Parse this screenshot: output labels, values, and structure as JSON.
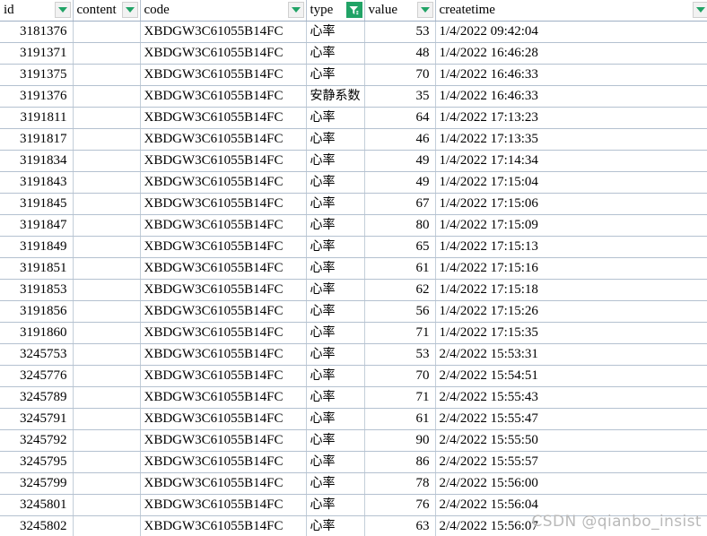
{
  "spreadsheet": {
    "columns": [
      {
        "key": "id",
        "label": "id",
        "align": "num",
        "filter": "dropdown"
      },
      {
        "key": "content",
        "label": "content",
        "align": "txt",
        "filter": "dropdown"
      },
      {
        "key": "code",
        "label": "code",
        "align": "txt",
        "filter": "dropdown"
      },
      {
        "key": "type",
        "label": "type",
        "align": "cn",
        "filter": "active"
      },
      {
        "key": "value",
        "label": "value",
        "align": "num",
        "filter": "dropdown"
      },
      {
        "key": "createtime",
        "label": "createtime",
        "align": "txt",
        "filter": "dropdown"
      }
    ],
    "rows": [
      {
        "id": "3181376",
        "content": "",
        "code": "XBDGW3C61055B14FC",
        "type": "心率",
        "value": "53",
        "createtime": "1/4/2022  09:42:04"
      },
      {
        "id": "3191371",
        "content": "",
        "code": "XBDGW3C61055B14FC",
        "type": "心率",
        "value": "48",
        "createtime": "1/4/2022  16:46:28"
      },
      {
        "id": "3191375",
        "content": "",
        "code": "XBDGW3C61055B14FC",
        "type": "心率",
        "value": "70",
        "createtime": "1/4/2022  16:46:33"
      },
      {
        "id": "3191376",
        "content": "",
        "code": "XBDGW3C61055B14FC",
        "type": "安静系数",
        "value": "35",
        "createtime": "1/4/2022  16:46:33"
      },
      {
        "id": "3191811",
        "content": "",
        "code": "XBDGW3C61055B14FC",
        "type": "心率",
        "value": "64",
        "createtime": "1/4/2022  17:13:23"
      },
      {
        "id": "3191817",
        "content": "",
        "code": "XBDGW3C61055B14FC",
        "type": "心率",
        "value": "46",
        "createtime": "1/4/2022  17:13:35"
      },
      {
        "id": "3191834",
        "content": "",
        "code": "XBDGW3C61055B14FC",
        "type": "心率",
        "value": "49",
        "createtime": "1/4/2022  17:14:34"
      },
      {
        "id": "3191843",
        "content": "",
        "code": "XBDGW3C61055B14FC",
        "type": "心率",
        "value": "49",
        "createtime": "1/4/2022  17:15:04"
      },
      {
        "id": "3191845",
        "content": "",
        "code": "XBDGW3C61055B14FC",
        "type": "心率",
        "value": "67",
        "createtime": "1/4/2022  17:15:06"
      },
      {
        "id": "3191847",
        "content": "",
        "code": "XBDGW3C61055B14FC",
        "type": "心率",
        "value": "80",
        "createtime": "1/4/2022  17:15:09"
      },
      {
        "id": "3191849",
        "content": "",
        "code": "XBDGW3C61055B14FC",
        "type": "心率",
        "value": "65",
        "createtime": "1/4/2022  17:15:13"
      },
      {
        "id": "3191851",
        "content": "",
        "code": "XBDGW3C61055B14FC",
        "type": "心率",
        "value": "61",
        "createtime": "1/4/2022  17:15:16"
      },
      {
        "id": "3191853",
        "content": "",
        "code": "XBDGW3C61055B14FC",
        "type": "心率",
        "value": "62",
        "createtime": "1/4/2022  17:15:18"
      },
      {
        "id": "3191856",
        "content": "",
        "code": "XBDGW3C61055B14FC",
        "type": "心率",
        "value": "56",
        "createtime": "1/4/2022  17:15:26"
      },
      {
        "id": "3191860",
        "content": "",
        "code": "XBDGW3C61055B14FC",
        "type": "心率",
        "value": "71",
        "createtime": "1/4/2022  17:15:35"
      },
      {
        "id": "3245753",
        "content": "",
        "code": "XBDGW3C61055B14FC",
        "type": "心率",
        "value": "53",
        "createtime": "2/4/2022  15:53:31"
      },
      {
        "id": "3245776",
        "content": "",
        "code": "XBDGW3C61055B14FC",
        "type": "心率",
        "value": "70",
        "createtime": "2/4/2022  15:54:51"
      },
      {
        "id": "3245789",
        "content": "",
        "code": "XBDGW3C61055B14FC",
        "type": "心率",
        "value": "71",
        "createtime": "2/4/2022  15:55:43"
      },
      {
        "id": "3245791",
        "content": "",
        "code": "XBDGW3C61055B14FC",
        "type": "心率",
        "value": "61",
        "createtime": "2/4/2022  15:55:47"
      },
      {
        "id": "3245792",
        "content": "",
        "code": "XBDGW3C61055B14FC",
        "type": "心率",
        "value": "90",
        "createtime": "2/4/2022  15:55:50"
      },
      {
        "id": "3245795",
        "content": "",
        "code": "XBDGW3C61055B14FC",
        "type": "心率",
        "value": "86",
        "createtime": "2/4/2022  15:55:57"
      },
      {
        "id": "3245799",
        "content": "",
        "code": "XBDGW3C61055B14FC",
        "type": "心率",
        "value": "78",
        "createtime": "2/4/2022  15:56:00"
      },
      {
        "id": "3245801",
        "content": "",
        "code": "XBDGW3C61055B14FC",
        "type": "心率",
        "value": "76",
        "createtime": "2/4/2022  15:56:04"
      },
      {
        "id": "3245802",
        "content": "",
        "code": "XBDGW3C61055B14FC",
        "type": "心率",
        "value": "63",
        "createtime": "2/4/2022  15:56:07"
      }
    ]
  },
  "watermark": {
    "text": "CSDN @qianbo_insist"
  },
  "colors": {
    "filter_accent": "#21a366",
    "grid_line": "#b4c1d0",
    "text": "#000000",
    "watermark": "#b9b9b9"
  }
}
